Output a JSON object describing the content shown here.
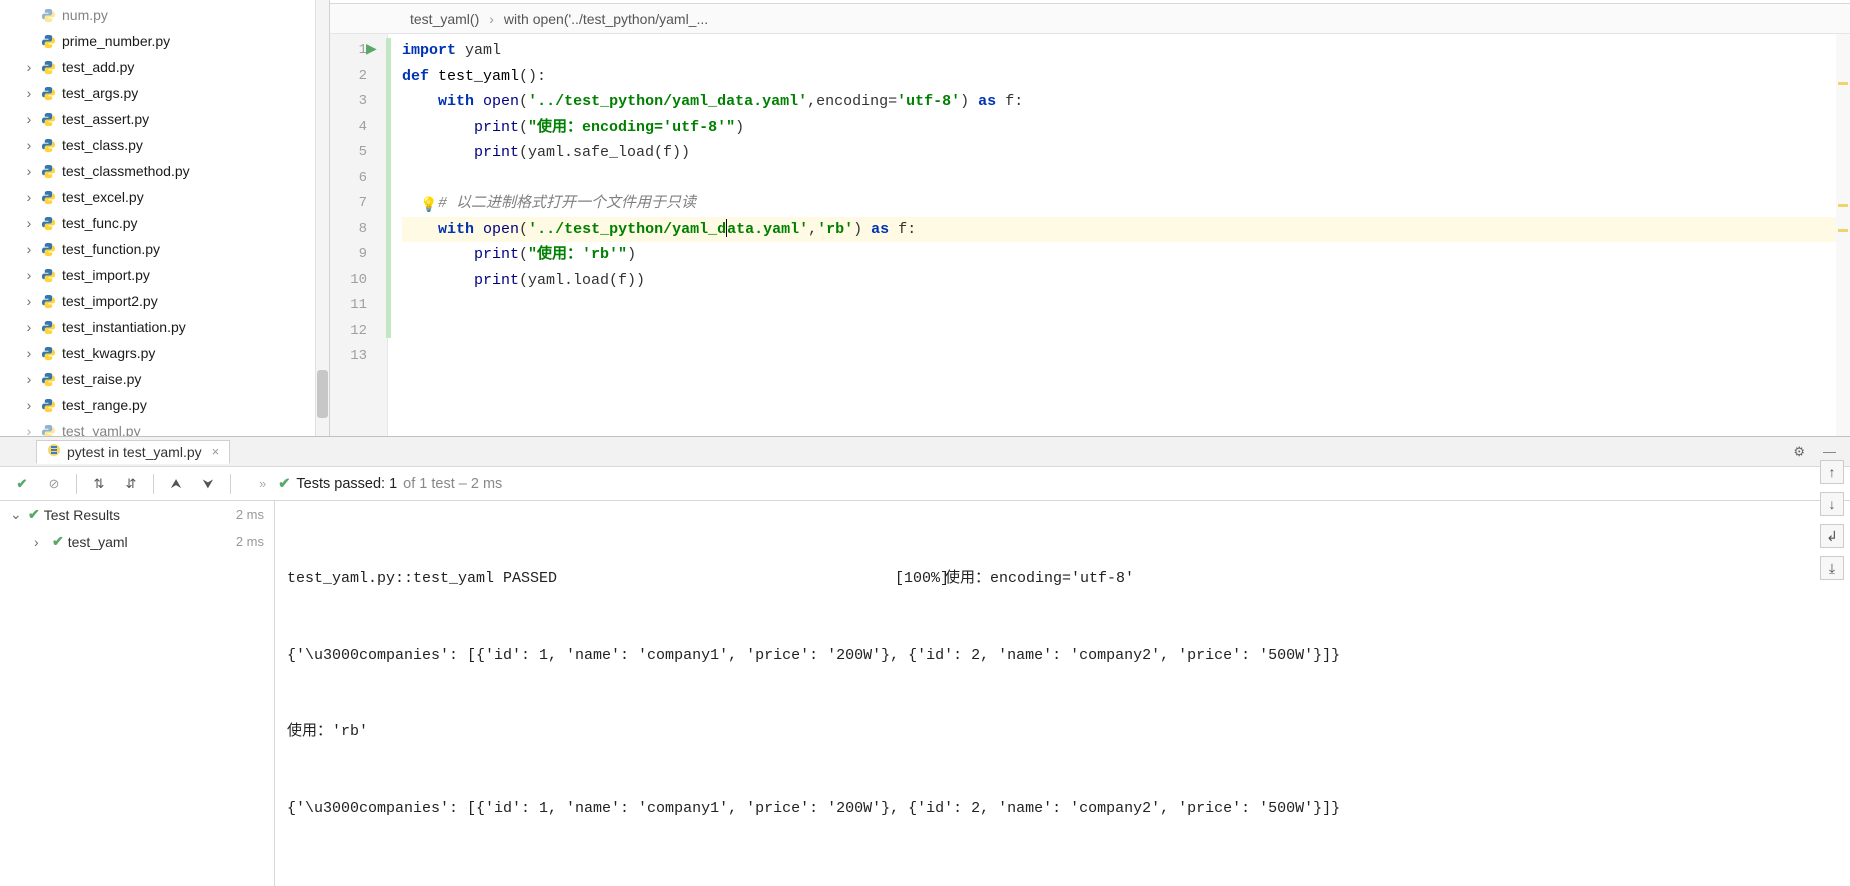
{
  "project_tree": [
    {
      "label": "num.py",
      "chev": false,
      "faded": true
    },
    {
      "label": "prime_number.py",
      "chev": false
    },
    {
      "label": "test_add.py",
      "chev": true
    },
    {
      "label": "test_args.py",
      "chev": true
    },
    {
      "label": "test_assert.py",
      "chev": true
    },
    {
      "label": "test_class.py",
      "chev": true
    },
    {
      "label": "test_classmethod.py",
      "chev": true
    },
    {
      "label": "test_excel.py",
      "chev": true
    },
    {
      "label": "test_func.py",
      "chev": true
    },
    {
      "label": "test_function.py",
      "chev": true
    },
    {
      "label": "test_import.py",
      "chev": true
    },
    {
      "label": "test_import2.py",
      "chev": true
    },
    {
      "label": "test_instantiation.py",
      "chev": true
    },
    {
      "label": "test_kwagrs.py",
      "chev": true
    },
    {
      "label": "test_raise.py",
      "chev": true
    },
    {
      "label": "test_range.py",
      "chev": true
    },
    {
      "label": "test_yaml.py",
      "chev": true,
      "faded": true
    }
  ],
  "breadcrumb": {
    "fn": "test_yaml()",
    "ctx": "with open('../test_python/yaml_..."
  },
  "code_lines": [
    {
      "n": 1,
      "segs": [
        [
          "kw",
          "import "
        ],
        [
          "pl",
          "yaml"
        ]
      ]
    },
    {
      "n": 2,
      "segs": [
        [
          "kw",
          "def "
        ],
        [
          "fn",
          "test_yaml"
        ],
        [
          "pl",
          "():"
        ]
      ]
    },
    {
      "n": 3,
      "segs": [
        [
          "pad",
          "    "
        ],
        [
          "kw",
          "with "
        ],
        [
          "builtin",
          "open"
        ],
        [
          "pl",
          "("
        ],
        [
          "str",
          "'../test_python/yaml_data.yaml'"
        ],
        [
          "pl",
          ","
        ],
        [
          "pl",
          "encoding="
        ],
        [
          "str",
          "'utf-8'"
        ],
        [
          "pl",
          ") "
        ],
        [
          "kw",
          "as "
        ],
        [
          "pl",
          "f:"
        ]
      ]
    },
    {
      "n": 4,
      "segs": [
        [
          "pad",
          "        "
        ],
        [
          "builtin",
          "print"
        ],
        [
          "pl",
          "("
        ],
        [
          "str",
          "\"使用：encoding='utf-8'\""
        ],
        [
          "pl",
          ")"
        ]
      ]
    },
    {
      "n": 5,
      "segs": [
        [
          "pad",
          "        "
        ],
        [
          "builtin",
          "print"
        ],
        [
          "pl",
          "(yaml.safe_load(f))"
        ]
      ]
    },
    {
      "n": 6,
      "segs": []
    },
    {
      "n": 7,
      "segs": [
        [
          "pad",
          "    "
        ],
        [
          "cmt",
          "# 以二进制格式打开一个文件用于只读"
        ]
      ]
    },
    {
      "n": 8,
      "hl": true,
      "segs": [
        [
          "pad",
          "    "
        ],
        [
          "kw",
          "with "
        ],
        [
          "builtin",
          "open"
        ],
        [
          "pl",
          "("
        ],
        [
          "str",
          "'../test_python/yaml_d"
        ],
        [
          "caret",
          ""
        ],
        [
          "str",
          "ata.yaml'"
        ],
        [
          "pl",
          ","
        ],
        [
          "str",
          "'rb'"
        ],
        [
          "pl",
          ") "
        ],
        [
          "kw",
          "as "
        ],
        [
          "pl",
          "f:"
        ]
      ]
    },
    {
      "n": 9,
      "segs": [
        [
          "pad",
          "        "
        ],
        [
          "builtin",
          "print"
        ],
        [
          "pl",
          "("
        ],
        [
          "str",
          "\"使用：'rb'\""
        ],
        [
          "pl",
          ")"
        ]
      ]
    },
    {
      "n": 10,
      "segs": [
        [
          "pad",
          "        "
        ],
        [
          "builtin",
          "print"
        ],
        [
          "pl",
          "(yaml.load(f))"
        ]
      ]
    },
    {
      "n": 11,
      "segs": []
    },
    {
      "n": 12,
      "segs": []
    },
    {
      "n": 13,
      "segs": []
    }
  ],
  "run_tab": {
    "label": "pytest in test_yaml.py"
  },
  "tests_status": {
    "passed": "Tests passed: 1",
    "tail": " of 1 test – 2 ms"
  },
  "test_tree": {
    "root": {
      "label": "Test Results",
      "time": "2 ms"
    },
    "child": {
      "label": "test_yaml",
      "time": "2 ms"
    }
  },
  "console": {
    "line1_left": "test_yaml.py::test_yaml PASSED",
    "line1_pct": "[100%]",
    "line1_right": "使用：encoding='utf-8'",
    "line2": "{'\\u3000companies': [{'id': 1, 'name': 'company1', 'price': '200W'}, {'id': 2, 'name': 'company2', 'price': '500W'}]}",
    "line3": "使用：'rb'",
    "line4": "{'\\u3000companies': [{'id': 1, 'name': 'company1', 'price': '200W'}, {'id': 2, 'name': 'company2', 'price': '500W'}]}"
  }
}
